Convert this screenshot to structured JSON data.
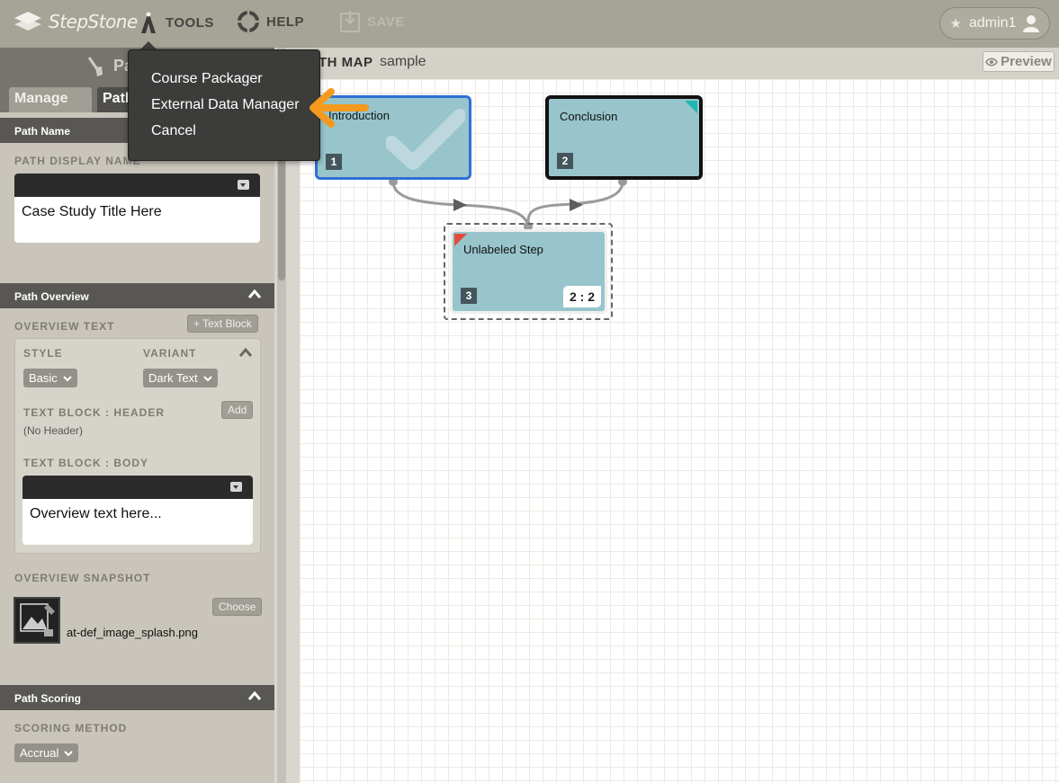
{
  "brand": {
    "name": "StepStone"
  },
  "topnav": {
    "tools": "TOOLS",
    "help": "HELP",
    "save": "SAVE"
  },
  "user": {
    "name": "admin1"
  },
  "tools_menu": {
    "items": [
      "Course Packager",
      "External Data Manager",
      "Cancel"
    ]
  },
  "sidebar": {
    "header_title": "Pa",
    "tabs": {
      "manage": "Manage",
      "path": "Path"
    },
    "path_name": {
      "title": "Path Name",
      "display_label": "PATH DISPLAY NAME",
      "display_value": "Case Study Title Here"
    },
    "overview": {
      "title": "Path Overview",
      "overview_text_label": "OVERVIEW TEXT",
      "text_block_button": "+ Text Block",
      "style_label": "STYLE",
      "style_value": "Basic",
      "variant_label": "VARIANT",
      "variant_value": "Dark Text",
      "header_label": "TEXT BLOCK : HEADER",
      "header_value": "(No Header)",
      "add_button": "Add",
      "body_label": "TEXT BLOCK : BODY",
      "body_value": "Overview text here...",
      "snapshot_label": "OVERVIEW SNAPSHOT",
      "choose_button": "Choose",
      "snapshot_file": "at-def_image_splash.png"
    },
    "scoring": {
      "title": "Path Scoring",
      "method_label": "SCORING METHOD",
      "method_value": "Accrual"
    }
  },
  "pathmap": {
    "title": "TH MAP",
    "name": "sample",
    "preview": "Preview",
    "nodes": [
      {
        "label": "Introduction",
        "number": "1"
      },
      {
        "label": "Conclusion",
        "number": "2"
      },
      {
        "label": "Unlabeled Step",
        "number": "3",
        "score": "2 : 2"
      }
    ]
  },
  "colors": {
    "accent_arrow": "#f39a1f",
    "node_fill": "#98c4cc",
    "selected_border": "#2f6fd6",
    "flag_red": "#e24b3b",
    "flag_teal": "#1fb7b3"
  }
}
